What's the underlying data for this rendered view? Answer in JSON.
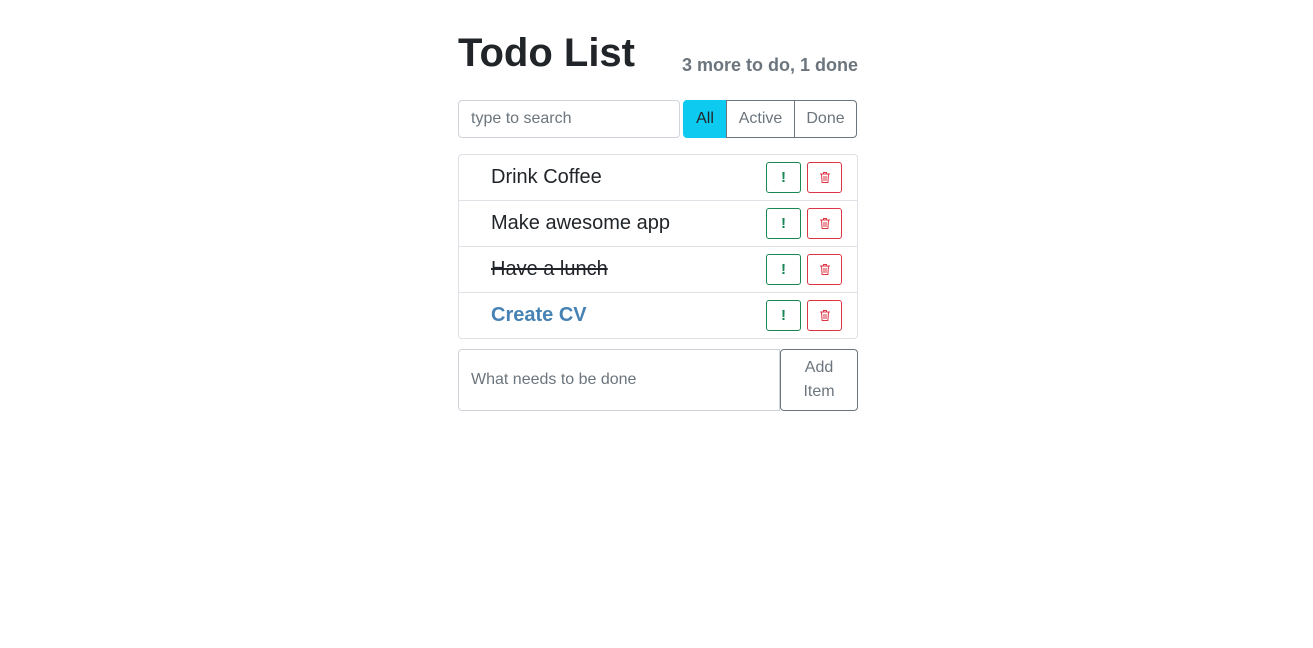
{
  "header": {
    "title": "Todo List",
    "counter": "3 more to do, 1 done"
  },
  "search": {
    "placeholder": "type to search",
    "value": ""
  },
  "filters": [
    {
      "label": "All",
      "selected": true
    },
    {
      "label": "Active",
      "selected": false
    },
    {
      "label": "Done",
      "selected": false
    }
  ],
  "todos": [
    {
      "label": "Drink Coffee",
      "done": false,
      "important": false
    },
    {
      "label": "Make awesome app",
      "done": false,
      "important": false
    },
    {
      "label": "Have a lunch",
      "done": true,
      "important": false
    },
    {
      "label": "Create CV",
      "done": false,
      "important": true
    }
  ],
  "item_buttons": {
    "important_icon": "exclamation-icon",
    "delete_icon": "trash-icon",
    "important_glyph": "!"
  },
  "add_form": {
    "placeholder": "What needs to be done",
    "value": "",
    "button_label": "Add Item"
  },
  "colors": {
    "filter_active_bg": "#0dcaf0",
    "important_text": "#4682b4",
    "important_button": "#198754",
    "delete_button": "#dc3545",
    "muted_text": "#6c757d"
  }
}
